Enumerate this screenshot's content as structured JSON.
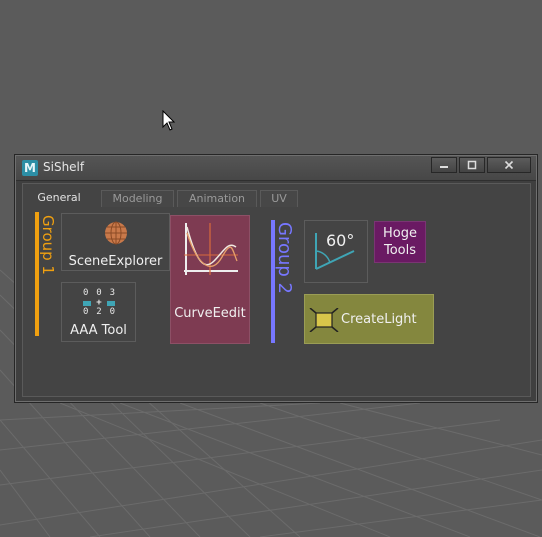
{
  "window": {
    "title": "SiShelf",
    "icon_letter": "M",
    "controls": [
      "minimize-icon",
      "maximize-icon",
      "close-icon"
    ]
  },
  "tabs": [
    {
      "label": "General",
      "active": true
    },
    {
      "label": "Modeling",
      "active": false
    },
    {
      "label": "Animation",
      "active": false
    },
    {
      "label": "UV",
      "active": false
    }
  ],
  "groups": [
    {
      "label": "Group 1",
      "color": "#f0a010",
      "buttons": [
        {
          "label": "SceneExplorer",
          "icon": "globe-icon",
          "bg": "#444444"
        },
        {
          "label": "AAA Tool",
          "icon": "number-grid-icon",
          "bg": "#444444",
          "icon_numbers": [
            "0",
            "0",
            "3",
            "+",
            "0",
            "2",
            "0"
          ]
        },
        {
          "label": "CurveEedit",
          "icon": "curve-graph-icon",
          "bg": "#7e3b52"
        }
      ]
    },
    {
      "label": "Group 2",
      "color": "#7777ff",
      "buttons": [
        {
          "label": "60°",
          "icon": "angle-60-icon",
          "bg": "#444444"
        },
        {
          "label_line1": "Hoge",
          "label_line2": "Tools",
          "bg": "#6a1a63"
        },
        {
          "label": "CreateLight",
          "icon": "area-light-icon",
          "bg": "#84873e"
        }
      ]
    }
  ],
  "colors": {
    "viewport_bg": "#5b5b5b",
    "grid": "#6a6a6a",
    "panel": "#444444"
  }
}
